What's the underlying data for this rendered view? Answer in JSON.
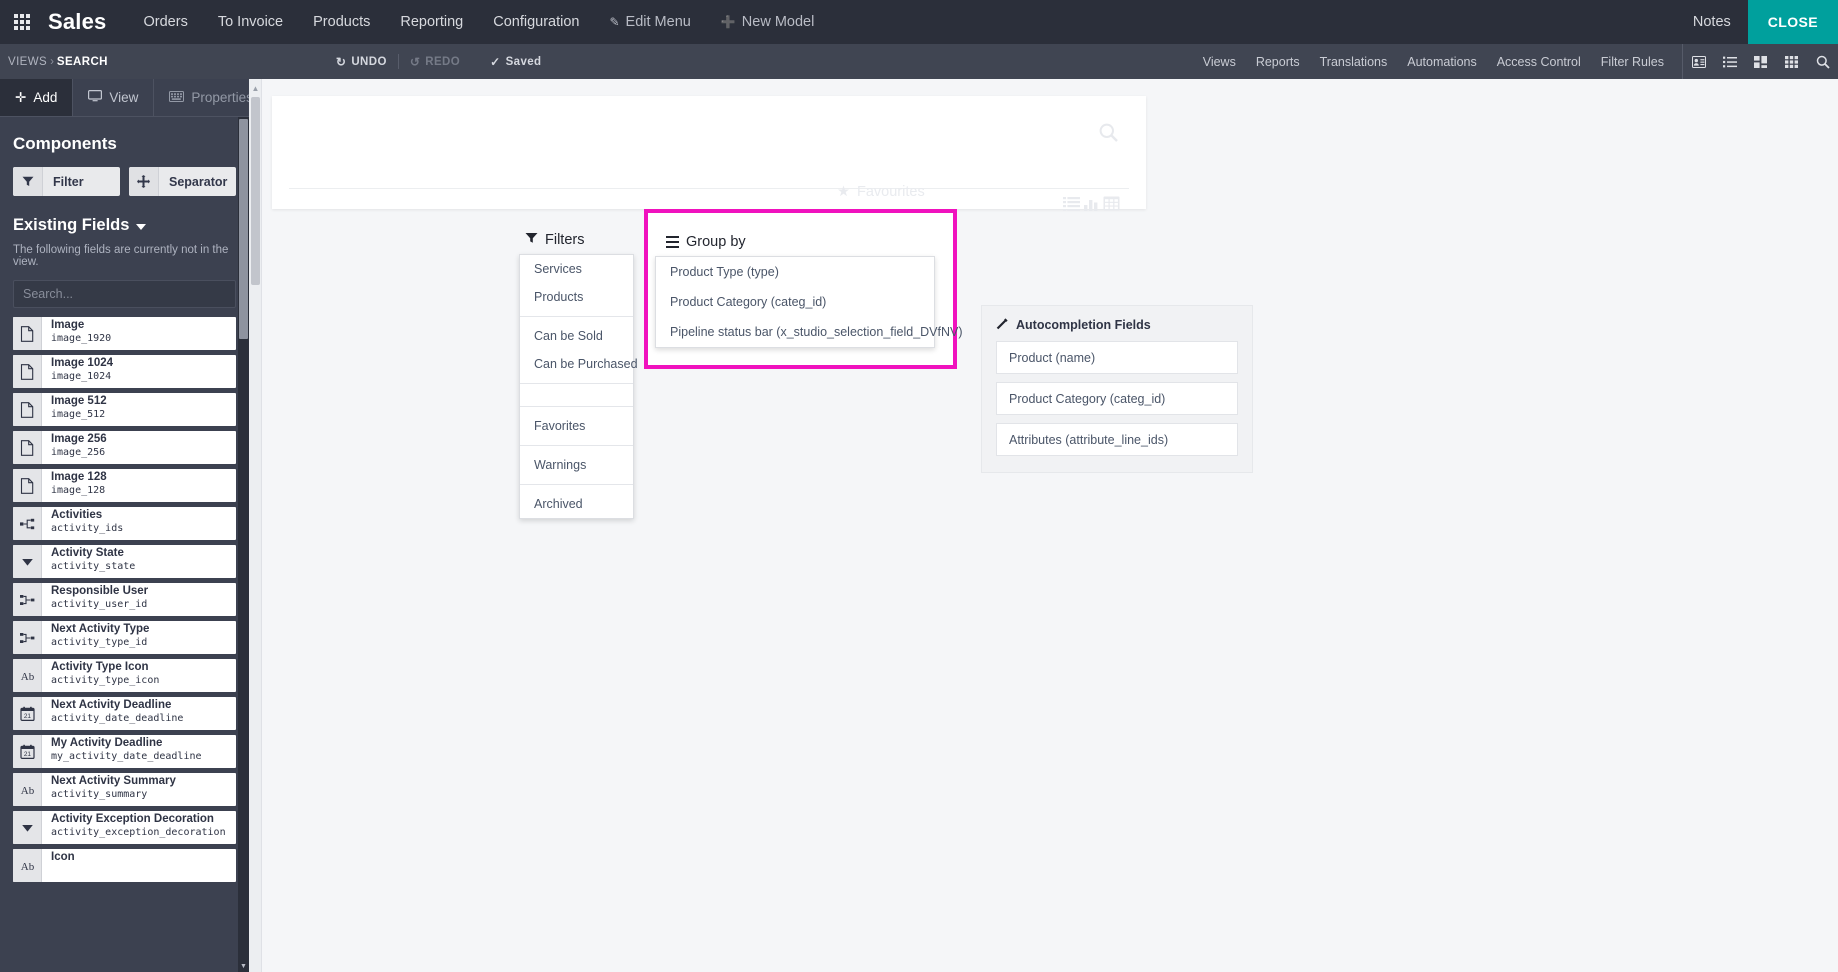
{
  "navbar": {
    "apps_icon": "apps-grid-icon",
    "brand": "Sales",
    "menus": [
      {
        "label": "Orders"
      },
      {
        "label": "To Invoice"
      },
      {
        "label": "Products"
      },
      {
        "label": "Reporting"
      },
      {
        "label": "Configuration"
      }
    ],
    "edit_menu": "Edit Menu",
    "new_model": "New Model",
    "notes": "Notes",
    "close": "CLOSE",
    "close_color": "#00A09D"
  },
  "subnav": {
    "views": "VIEWS",
    "separator": "›",
    "search": "SEARCH",
    "undo": "UNDO",
    "redo": "REDO",
    "saved": "Saved",
    "links": [
      {
        "label": "Views"
      },
      {
        "label": "Reports"
      },
      {
        "label": "Translations"
      },
      {
        "label": "Automations"
      },
      {
        "label": "Access Control"
      },
      {
        "label": "Filter Rules"
      }
    ],
    "icons": [
      "contact-card-icon",
      "list-view-icon",
      "kanban-view-icon",
      "grid-view-icon",
      "search-icon"
    ]
  },
  "sidebar": {
    "tabs": [
      {
        "label": "Add",
        "icon": "plus-icon",
        "active": true
      },
      {
        "label": "View",
        "icon": "monitor-icon",
        "active": false
      },
      {
        "label": "Properties",
        "icon": "properties-icon",
        "active": false
      }
    ],
    "components_title": "Components",
    "components": [
      {
        "label": "Filter",
        "icon": "funnel-icon"
      },
      {
        "label": "Separator",
        "icon": "move-cross-icon"
      }
    ],
    "existing_fields_title": "Existing Fields",
    "existing_fields_note": "The following fields are currently not in the view.",
    "search_placeholder": "Search...",
    "fields": [
      {
        "label": "Image",
        "tech": "image_1920",
        "icon": "binary-file-icon"
      },
      {
        "label": "Image 1024",
        "tech": "image_1024",
        "icon": "binary-file-icon"
      },
      {
        "label": "Image 512",
        "tech": "image_512",
        "icon": "binary-file-icon"
      },
      {
        "label": "Image 256",
        "tech": "image_256",
        "icon": "binary-file-icon"
      },
      {
        "label": "Image 128",
        "tech": "image_128",
        "icon": "binary-file-icon"
      },
      {
        "label": "Activities",
        "tech": "activity_ids",
        "icon": "one2many-icon"
      },
      {
        "label": "Activity State",
        "tech": "activity_state",
        "icon": "selection-icon"
      },
      {
        "label": "Responsible User",
        "tech": "activity_user_id",
        "icon": "many2one-icon"
      },
      {
        "label": "Next Activity Type",
        "tech": "activity_type_id",
        "icon": "many2one-icon"
      },
      {
        "label": "Activity Type Icon",
        "tech": "activity_type_icon",
        "icon": "text-icon"
      },
      {
        "label": "Next Activity Deadline",
        "tech": "activity_date_deadline",
        "icon": "date-icon"
      },
      {
        "label": "My Activity Deadline",
        "tech": "my_activity_date_deadline",
        "icon": "date-icon"
      },
      {
        "label": "Next Activity Summary",
        "tech": "activity_summary",
        "icon": "text-icon"
      },
      {
        "label": "Activity Exception Decoration",
        "tech": "activity_exception_decoration",
        "icon": "selection-icon"
      },
      {
        "label": "Icon",
        "tech": "",
        "icon": "text-icon"
      }
    ]
  },
  "canvas": {
    "favourites_label": "Favourites",
    "filters": {
      "label": "Filters",
      "icon": "funnel-icon",
      "groups": [
        [
          "Services",
          "Products"
        ],
        [
          "Can be Sold",
          "Can be Purchased"
        ],
        [],
        [
          "Favorites"
        ],
        [
          "Warnings"
        ],
        [
          "Archived"
        ]
      ]
    },
    "group_by": {
      "label": "Group by",
      "icon": "bars-icon",
      "highlight_color": "#f012be",
      "items": [
        "Product Type (type)",
        "Product Category (categ_id)",
        "Pipeline status bar (x_studio_selection_field_DVfNV)"
      ]
    },
    "autocompletion": {
      "title": "Autocompletion Fields",
      "icon": "magic-wand-icon",
      "items": [
        "Product (name)",
        "Product Category (categ_id)",
        "Attributes (attribute_line_ids)"
      ]
    }
  }
}
